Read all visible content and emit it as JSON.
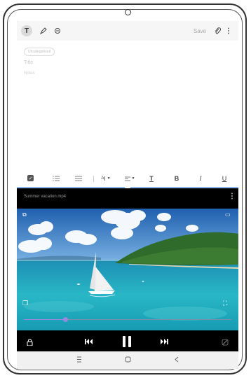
{
  "notes": {
    "toolbar": {
      "text_mode": "T",
      "save_label": "Save"
    },
    "category_label": "Uncategorised",
    "title_placeholder": "Title",
    "notes_placeholder": "Notes",
    "format": {
      "bold": "B",
      "italic": "I",
      "underline": "U",
      "text_color": "T"
    }
  },
  "video": {
    "file_name": "Summer vacation.mp4",
    "current_time": "",
    "total_time": "",
    "progress": 0.2
  },
  "colors": {
    "split_divider": "#8ab4e8",
    "progress_thumb": "#9b86e0"
  }
}
